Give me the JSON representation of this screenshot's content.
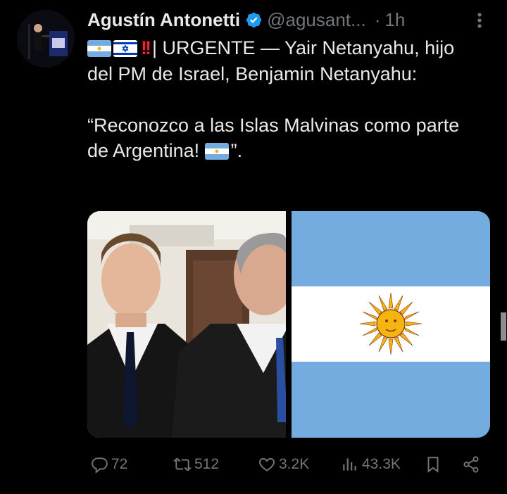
{
  "tweet": {
    "author_name": "Agustín Antonetti",
    "handle": "@agusant...",
    "separator": "·",
    "time": "1h",
    "urgent_label": "| URGENTE — Yair Netanyahu, hijo del PM de Israel, Benjamin Netanyahu:",
    "quote_line": "“Reconozco a las Islas Malvinas como parte de Argentina!",
    "quote_end": "”."
  },
  "actions": {
    "replies": "72",
    "reposts": "512",
    "likes": "3.2K",
    "views": "43.3K"
  },
  "colors": {
    "background": "#000000",
    "text": "#e7e9ea",
    "muted": "#71767b",
    "verified": "#1d9bf0",
    "argentina_blue": "#74acdf"
  },
  "icons": [
    "verified-badge-icon",
    "more-icon",
    "argentina-flag-icon",
    "israel-flag-icon",
    "double-exclamation-icon",
    "reply-icon",
    "repost-icon",
    "like-icon",
    "views-icon",
    "bookmark-icon",
    "share-icon"
  ]
}
